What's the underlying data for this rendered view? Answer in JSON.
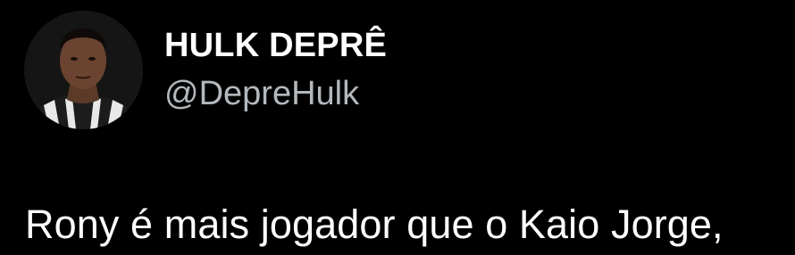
{
  "author": {
    "display_name": "HULK DEPRÊ",
    "handle": "@DepreHulk",
    "avatar_icon": "profile-photo"
  },
  "tweet": {
    "text": "Rony é mais jogador que o Kaio Jorge,"
  },
  "colors": {
    "background": "#000000",
    "name": "#ffffff",
    "handle": "#b3b8bd",
    "text": "#ffffff"
  }
}
